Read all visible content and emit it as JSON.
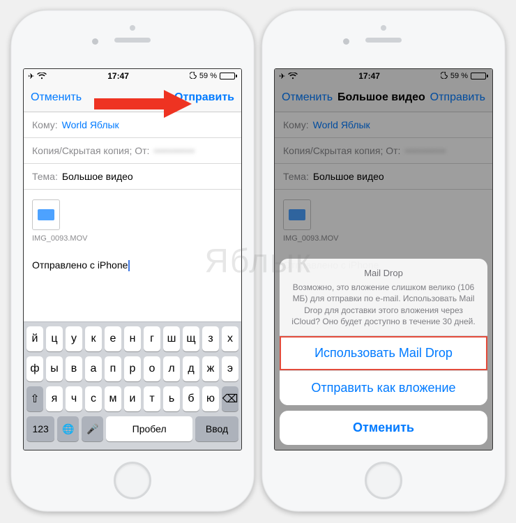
{
  "status": {
    "time": "17:47",
    "battery_pct": "59 %",
    "airplane": "✈",
    "wifi": "wifi-icon",
    "dnd": "moon-icon"
  },
  "left": {
    "nav": {
      "cancel": "Отменить",
      "send": "Отправить"
    },
    "compose": {
      "to_label": "Кому:",
      "to_value": "World Яблык",
      "cc_label": "Копия/Скрытая копия; От:",
      "cc_value": "••••••••••••",
      "subject_label": "Тема:",
      "subject_value": "Большое видео",
      "attachment_name": "IMG_0093.MOV",
      "signature": "Отправлено с iPhone"
    },
    "keyboard": {
      "rows": [
        [
          "й",
          "ц",
          "у",
          "к",
          "е",
          "н",
          "г",
          "ш",
          "щ",
          "з",
          "х"
        ],
        [
          "ф",
          "ы",
          "в",
          "а",
          "п",
          "р",
          "о",
          "л",
          "д",
          "ж",
          "э"
        ],
        [
          "я",
          "ч",
          "с",
          "м",
          "и",
          "т",
          "ь",
          "б",
          "ю"
        ]
      ],
      "shift": "⇧",
      "backspace": "⌫",
      "numbers": "123",
      "globe": "🌐",
      "mic": "🎤",
      "space": "Пробел",
      "enter": "Ввод"
    }
  },
  "right": {
    "nav": {
      "cancel": "Отменить",
      "title": "Большое видео",
      "send": "Отправить"
    },
    "sheet": {
      "title": "Mail Drop",
      "message": "Возможно, это вложение слишком велико (106 МБ) для отправки по e-mail. Использовать Mail Drop для доставки этого вложения через iCloud? Оно будет доступно в течение 30 дней.",
      "use_maildrop": "Использовать Mail Drop",
      "send_attachment": "Отправить как вложение",
      "cancel": "Отменить"
    }
  },
  "watermark": "Яблык"
}
